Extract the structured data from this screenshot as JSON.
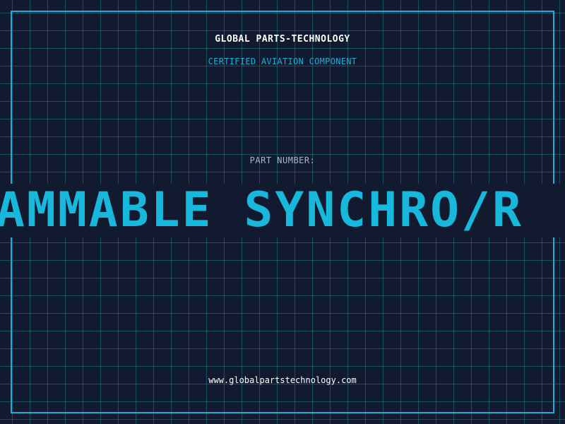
{
  "header": {
    "company_name": "GLOBAL PARTS-TECHNOLOGY",
    "tagline": "CERTIFIED AVIATION COMPONENT"
  },
  "part": {
    "label": "PART NUMBER:",
    "number_visible": "RAMMABLE SYNCHRO/R"
  },
  "footer": {
    "website": "www.globalpartstechnology.com"
  },
  "colors": {
    "background": "#111a2e",
    "grid": "#1f7a8c",
    "accent": "#18b0d8",
    "label_gray": "#a8b8c8",
    "white": "#ffffff"
  }
}
